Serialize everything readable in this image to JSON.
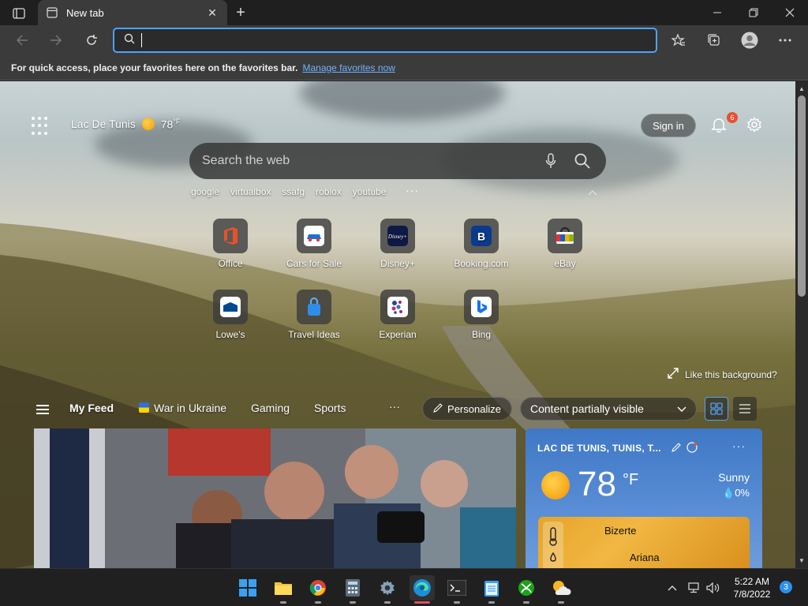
{
  "browser": {
    "tab": {
      "title": "New tab"
    },
    "address": {
      "value": "",
      "placeholder": ""
    },
    "favorites_bar": {
      "message": "For quick access, place your favorites here on the favorites bar.",
      "link": "Manage favorites now"
    }
  },
  "newtab": {
    "location": "Lac De Tunis",
    "temperature": "78",
    "temp_unit": "°F",
    "sign_in": "Sign in",
    "notifications_count": "6",
    "search": {
      "placeholder": "Search the web"
    },
    "suggestions": [
      "google",
      "virtualbox",
      "ssafg",
      "roblox",
      "youtube"
    ],
    "more": "···",
    "quick_links": [
      {
        "label": "Office"
      },
      {
        "label": "Cars for Sale"
      },
      {
        "label": "Disney+"
      },
      {
        "label": "Booking.com"
      },
      {
        "label": "eBay"
      },
      {
        "label": "Lowe's"
      },
      {
        "label": "Travel Ideas"
      },
      {
        "label": "Experian"
      },
      {
        "label": "Bing"
      }
    ],
    "like_background": "Like this background?",
    "feed": {
      "tabs": [
        "My Feed",
        "War in Ukraine",
        "Gaming",
        "Sports"
      ],
      "more": "···",
      "personalize": "Personalize",
      "visibility": "Content partially visible"
    },
    "weather": {
      "title": "LAC DE TUNIS, TUNIS, T...",
      "temp": "78",
      "unit": "°F",
      "condition": "Sunny",
      "precip": "0%",
      "map_labels": [
        "Bizerte",
        "Ariana"
      ],
      "more": "···"
    }
  },
  "taskbar": {
    "time": "5:22 AM",
    "date": "7/8/2022",
    "notifications": "3"
  },
  "colors": {
    "accent": "#4ea1ff",
    "badge": "#e8502f",
    "taskbar_badge": "#2d8ff0"
  }
}
